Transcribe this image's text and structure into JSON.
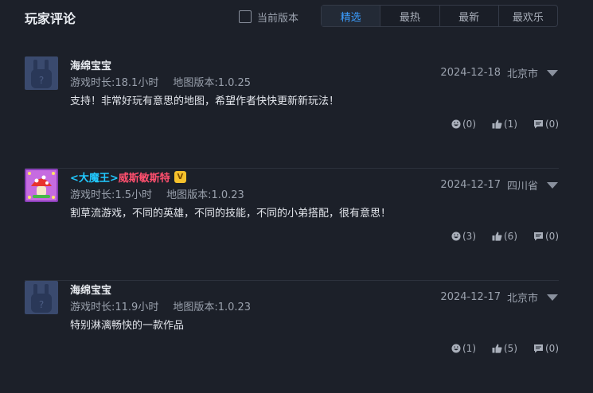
{
  "header": {
    "title": "玩家评论",
    "checkbox_label": "当前版本",
    "tabs": [
      "精选",
      "最热",
      "最新",
      "最欢乐"
    ],
    "active_tab": 0
  },
  "colors": {
    "accent": "#3b9dff",
    "background": "#1c2029",
    "vip_badge": "#f5c12c",
    "name_prefix": "#21c8ff",
    "name_suffix": "#ff4f6e"
  },
  "comments": [
    {
      "avatar": "rabbit-avatar",
      "name": "海绵宝宝",
      "playtime": "游戏时长:18.1小时",
      "map_version": "地图版本:1.0.25",
      "text": "支持！非常好玩有意思的地图，希望作者快快更新新玩法！",
      "date": "2024-12-18",
      "location": "北京市",
      "stats": {
        "laugh": "(0)",
        "like": "(1)",
        "reply": "(0)"
      }
    },
    {
      "avatar": "mushroom-avatar",
      "name_prefix": "<大魔王>",
      "name_suffix": "威斯敏斯特",
      "badge": "V",
      "playtime": "游戏时长:1.5小时",
      "map_version": "地图版本:1.0.23",
      "text": "割草流游戏，不同的英雄，不同的技能，不同的小弟搭配，很有意思！",
      "date": "2024-12-17",
      "location": "四川省",
      "stats": {
        "laugh": "(3)",
        "like": "(6)",
        "reply": "(0)"
      }
    },
    {
      "avatar": "rabbit-avatar",
      "name": "海绵宝宝",
      "playtime": "游戏时长:11.9小时",
      "map_version": "地图版本:1.0.23",
      "text": "特别淋漓畅快的一款作品",
      "date": "2024-12-17",
      "location": "北京市",
      "stats": {
        "laugh": "(1)",
        "like": "(5)",
        "reply": "(0)"
      }
    }
  ]
}
